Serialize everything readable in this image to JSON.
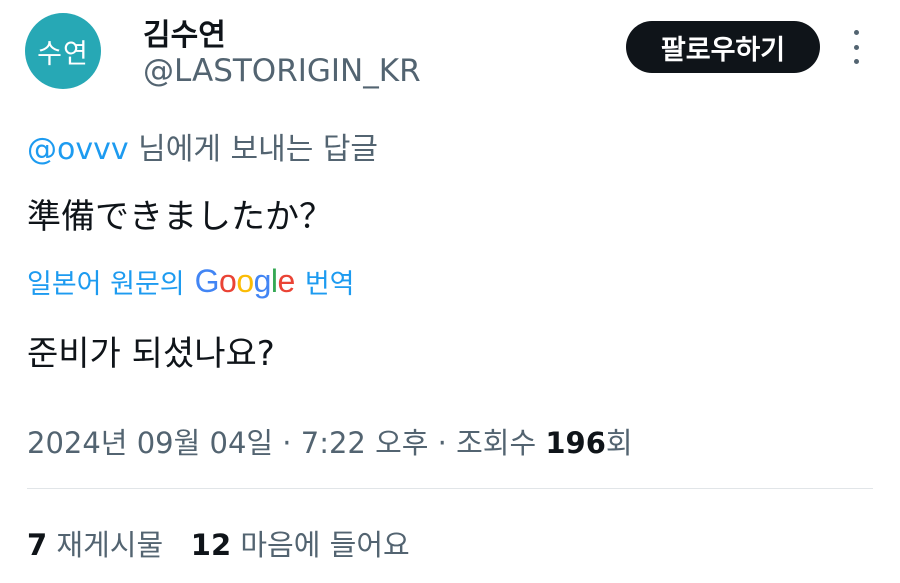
{
  "user": {
    "avatar_text": "수연",
    "avatar_color": "#27a8b5",
    "display_name": "김수연",
    "handle": "@LASTORIGIN_KR"
  },
  "follow_button": {
    "label": "팔로우하기"
  },
  "more_button": {
    "icon": "more-vertical-icon"
  },
  "reply_context": {
    "mention": "@ovvv",
    "suffix": " 님에게 보내는 답글"
  },
  "tweet": {
    "text": "準備できましたか？"
  },
  "translation": {
    "prefix": "일본어 원문의",
    "logo_text": "Google",
    "suffix": "번역",
    "text": "준비가 되셨나요?"
  },
  "meta": {
    "date": "2024년 09월 04일",
    "time": "7:22 오후",
    "views_label": "조회수",
    "views_count": "196",
    "views_suffix": "회"
  },
  "stats": {
    "retweets_count": "7",
    "retweets_label": "재게시물",
    "likes_count": "12",
    "likes_label": "마음에 들어요"
  },
  "colors": {
    "accent": "#1d9bf0",
    "text": "#0f1419",
    "secondary": "#536471"
  }
}
